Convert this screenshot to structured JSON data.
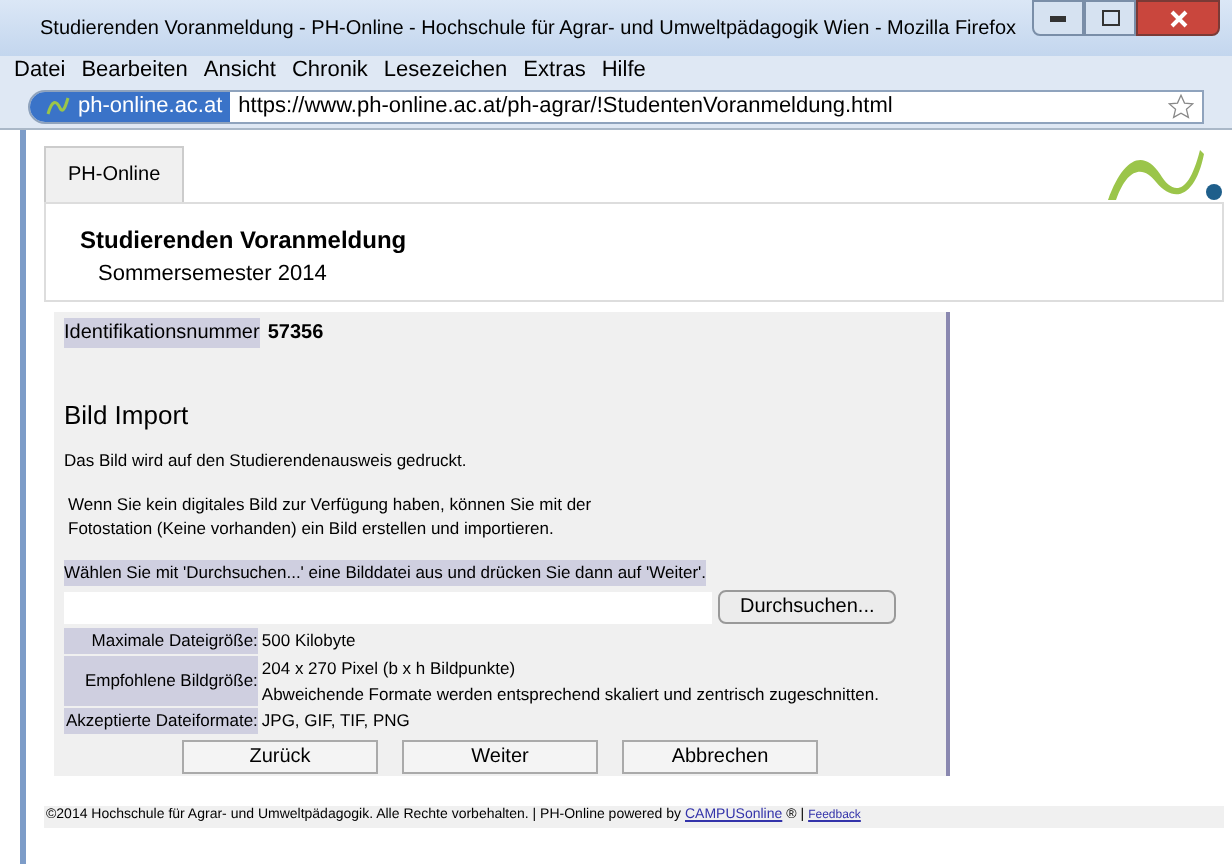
{
  "window": {
    "title": "Studierenden Voranmeldung - PH-Online - Hochschule für Agrar- und Umweltpädagogik Wien - Mozilla Firefox"
  },
  "menu": [
    "Datei",
    "Bearbeiten",
    "Ansicht",
    "Chronik",
    "Lesezeichen",
    "Extras",
    "Hilfe"
  ],
  "address_bar": {
    "site": "ph-online.ac.at",
    "url": "https://www.ph-online.ac.at/ph-agrar/!StudentenVoranmeldung.html"
  },
  "tabs": [
    {
      "label": "PH-Online",
      "selected": true
    }
  ],
  "header": {
    "title": "Studierenden Voranmeldung",
    "subtitle": "Sommersemester 2014"
  },
  "form": {
    "id_label": "Identifikationsnummer",
    "id_value": "57356",
    "heading": "Bild Import",
    "intro": "Das Bild wird auf den Studierendenausweis gedruckt.",
    "hint_lines": [
      "Wenn Sie kein digitales Bild zur Verfügung haben, können Sie mit der",
      "Fotostation (Keine vorhanden) ein Bild erstellen und importieren."
    ],
    "instruction": "Wählen Sie mit 'Durchsuchen...' eine Bilddatei aus und drücken Sie dann auf 'Weiter'.",
    "browse_button": "Durchsuchen...",
    "info": [
      {
        "label": "Maximale Dateigröße:",
        "values": [
          "500 Kilobyte"
        ]
      },
      {
        "label": "Empfohlene Bildgröße:",
        "values": [
          "204 x 270 Pixel (b x h Bildpunkte)",
          "Abweichende Formate werden entsprechend skaliert und zentrisch zugeschnitten."
        ]
      },
      {
        "label": "Akzeptierte Dateiformate:",
        "values": [
          "JPG, GIF, TIF, PNG"
        ]
      }
    ],
    "buttons": [
      "Zurück",
      "Weiter",
      "Abbrechen"
    ]
  },
  "footer": {
    "text": "©2014 Hochschule für Agrar- und Umweltpädagogik. Alle Rechte vorbehalten. | PH-Online powered by",
    "link": "CAMPUSonline",
    "after_link": "® |",
    "feedback": "Feedback"
  }
}
